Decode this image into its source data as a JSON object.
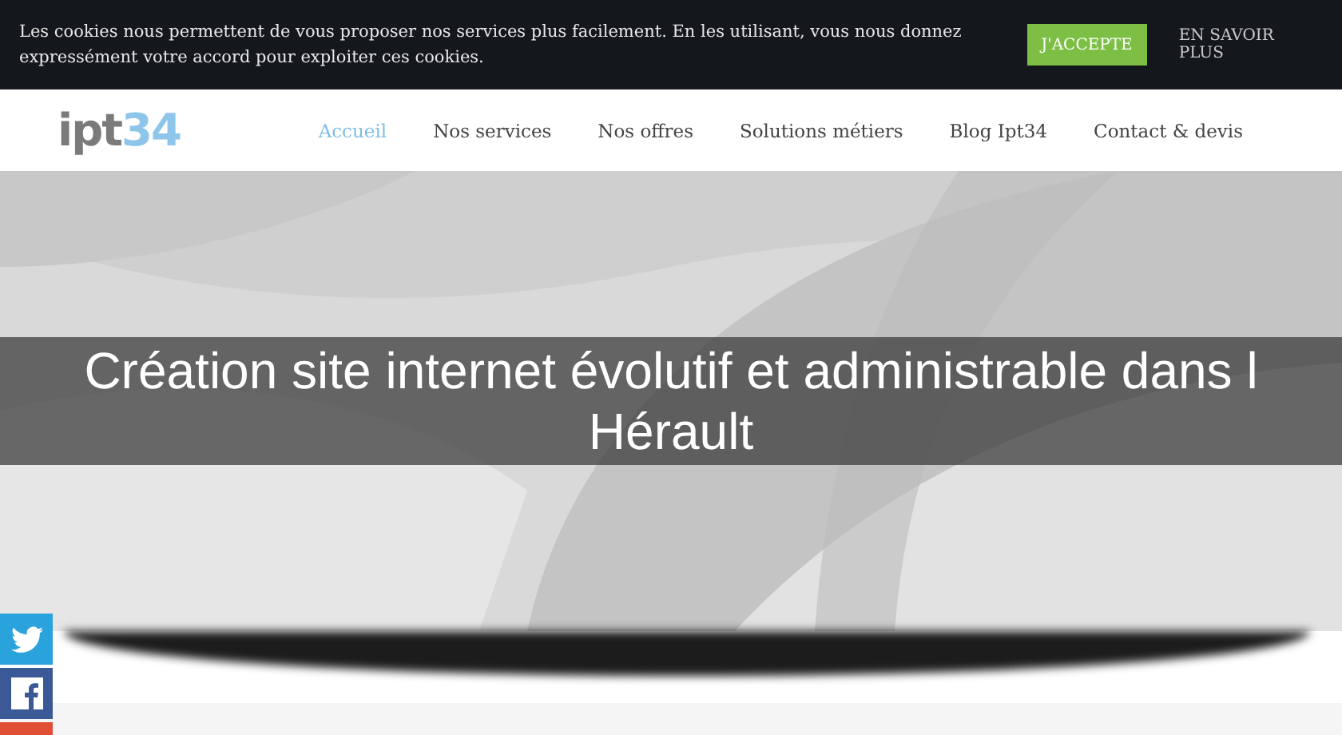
{
  "cookie_bar": {
    "message": "Les cookies nous permettent de vous proposer nos services plus facilement. En les utilisant, vous nous donnez expressément votre accord pour exploiter ces cookies.",
    "accept": "J'ACCEPTE",
    "more": "EN SAVOIR PLUS"
  },
  "header": {
    "logo": {
      "grey": "ipt",
      "blue": "34"
    },
    "nav": [
      {
        "label": "Accueil",
        "selected": true
      },
      {
        "label": "Nos services",
        "selected": false
      },
      {
        "label": "Nos offres",
        "selected": false
      },
      {
        "label": "Solutions métiers",
        "selected": false
      },
      {
        "label": "Blog Ipt34",
        "selected": false
      },
      {
        "label": "Contact & devis",
        "selected": false
      }
    ]
  },
  "hero": {
    "title": "Création site internet évolutif et administrable dans l Hérault"
  },
  "social": [
    {
      "kind": "twitter"
    },
    {
      "kind": "facebook"
    },
    {
      "kind": "other"
    }
  ]
}
